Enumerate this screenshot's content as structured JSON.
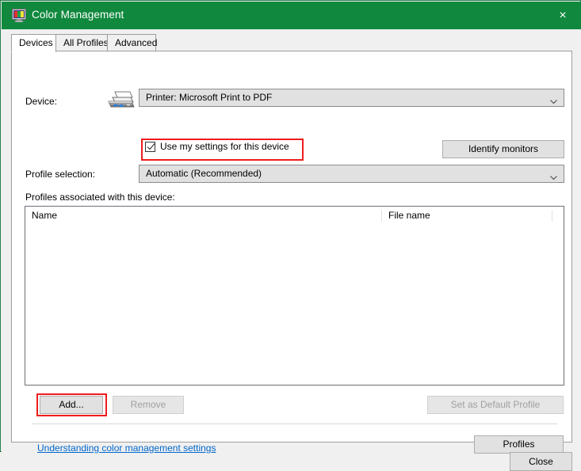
{
  "window": {
    "title": "Color Management",
    "title_icon": "color-monitor-icon",
    "close_glyph": "×",
    "accent_color": "#10893e",
    "border_color": "#2a7d4f"
  },
  "tabs": [
    {
      "label": "Devices",
      "selected": true
    },
    {
      "label": "All Profiles",
      "selected": false
    },
    {
      "label": "Advanced",
      "selected": false
    }
  ],
  "devices_tab": {
    "device_label": "Device:",
    "device_icon": "printer-icon",
    "device_combo_value": "Printer: Microsoft Print to PDF",
    "use_my_settings": {
      "label": "Use my settings for this device",
      "checked": true
    },
    "identify_monitors_label": "Identify monitors",
    "profile_selection_label": "Profile selection:",
    "profile_selection_value": "Automatic (Recommended)",
    "profiles_assoc_label": "Profiles associated with this device:",
    "list_columns": [
      "Name",
      "File name",
      ""
    ],
    "list_rows": [],
    "buttons": {
      "add": "Add...",
      "remove": "Remove",
      "set_default": "Set as Default Profile",
      "profiles": "Profiles"
    },
    "help_link": "Understanding color management settings"
  },
  "footer": {
    "close_label": "Close"
  },
  "annotations": {
    "highlight_color": "#ee1c1c",
    "boxes": [
      "use-my-settings-checkbox",
      "add-button"
    ]
  }
}
